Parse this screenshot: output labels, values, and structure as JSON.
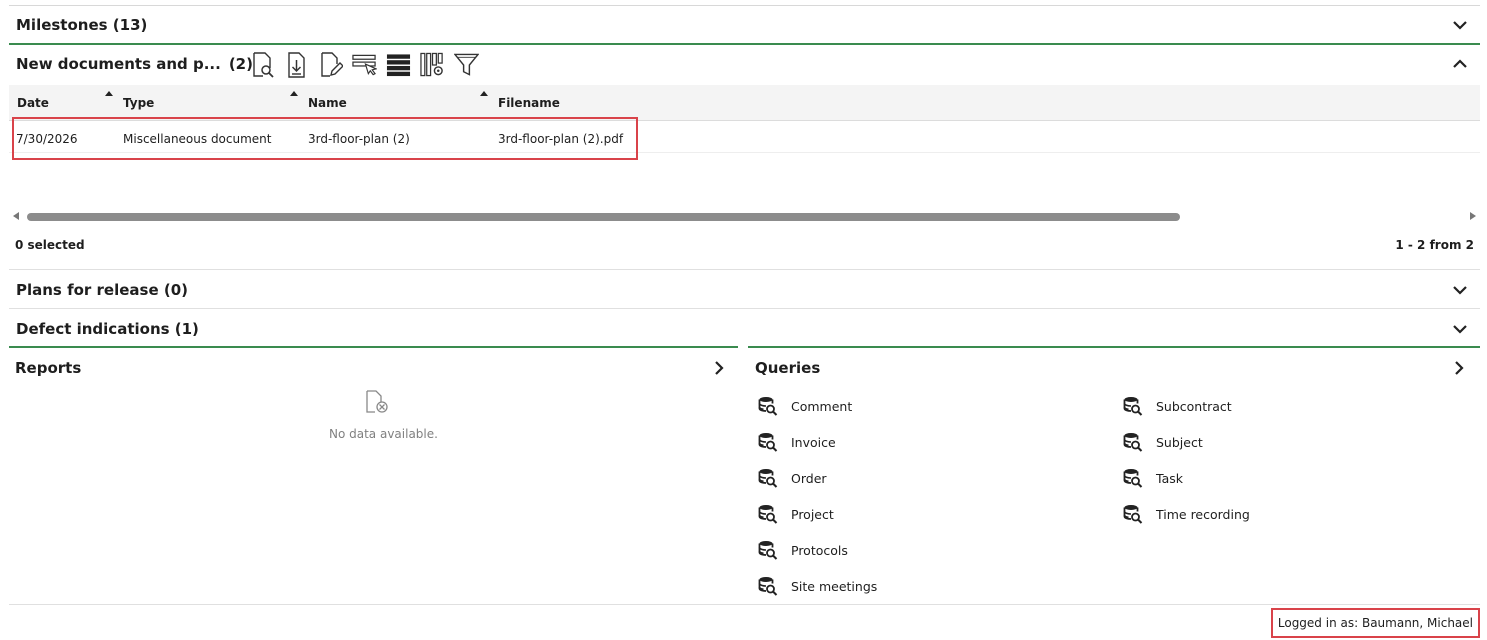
{
  "milestones": {
    "title": "Milestones (13)"
  },
  "new_documents": {
    "title": "New documents and p...",
    "count": "(2)",
    "toolbar": [
      {
        "icon": "preview-document-icon"
      },
      {
        "icon": "download-document-icon"
      },
      {
        "icon": "edit-document-icon"
      },
      {
        "icon": "select-columns-icon"
      },
      {
        "icon": "list-view-icon"
      },
      {
        "icon": "column-settings-icon"
      },
      {
        "icon": "filter-icon"
      }
    ],
    "table": {
      "columns": [
        "Date",
        "Type",
        "Name",
        "Filename"
      ],
      "rows": [
        {
          "date": "7/30/2026",
          "type": "Miscellaneous document",
          "name": "3rd-floor-plan (2)",
          "filename": "3rd-floor-plan (2).pdf"
        }
      ]
    },
    "selected": "0 selected",
    "pagination": "1 - 2 from 2"
  },
  "plans_for_release": {
    "title": "Plans for release (0)"
  },
  "defect_indications": {
    "title": "Defect indications (1)"
  },
  "reports": {
    "title": "Reports",
    "empty_text": "No data available."
  },
  "queries": {
    "title": "Queries",
    "left": [
      "Comment",
      "Invoice",
      "Order",
      "Project",
      "Protocols",
      "Site meetings"
    ],
    "right": [
      "Subcontract",
      "Subject",
      "Task",
      "Time recording"
    ]
  },
  "status": {
    "logged_in": "Logged in as: Baumann, Michael"
  },
  "colors": {
    "accent_green": "#3a8b4f",
    "highlight_red": "#d9434a"
  }
}
